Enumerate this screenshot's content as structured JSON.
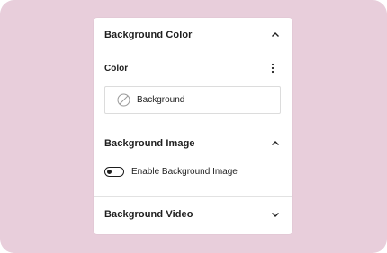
{
  "panel": {
    "sections": [
      {
        "title": "Background Color",
        "expanded": true
      },
      {
        "title": "Background Image",
        "expanded": true
      },
      {
        "title": "Background Video",
        "expanded": false
      }
    ],
    "color": {
      "label": "Color",
      "menu_icon": "kebab-vertical-icon",
      "field_label": "Background",
      "swatch_icon": "no-color-icon"
    },
    "image": {
      "toggle_label": "Enable Background Image",
      "toggle_on": false
    }
  },
  "colors": {
    "backdrop": "#e8cedb",
    "panel": "#ffffff",
    "text": "#1e1e1e",
    "divider": "#e2e2e2"
  }
}
